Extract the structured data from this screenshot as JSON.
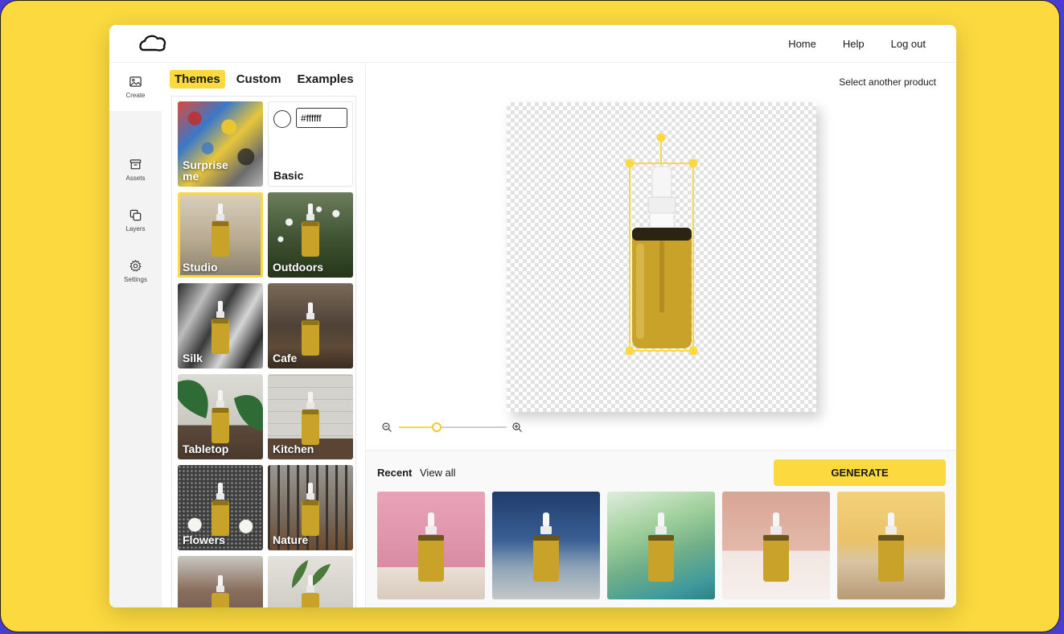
{
  "nav": {
    "home": "Home",
    "help": "Help",
    "logout": "Log out"
  },
  "rail": [
    {
      "label": "Create",
      "icon": "image-icon"
    },
    {
      "label": "Assets",
      "icon": "archive-icon"
    },
    {
      "label": "Layers",
      "icon": "layers-icon"
    },
    {
      "label": "Settings",
      "icon": "gear-icon"
    }
  ],
  "tabs": [
    "Themes",
    "Custom",
    "Examples"
  ],
  "basic": {
    "hex_value": "#ffffff"
  },
  "themes": [
    "Surprise me",
    "Basic",
    "Studio",
    "Outdoors",
    "Silk",
    "Cafe",
    "Tabletop",
    "Kitchen",
    "Flowers",
    "Nature"
  ],
  "select_product": "Select another product",
  "zoom_level": 0.35,
  "recent": {
    "title": "Recent",
    "view_all": "View all"
  },
  "generate_label": "GENERATE",
  "colors": {
    "accent": "#fbd93f",
    "background": "#4a3bd1",
    "oil": "#c9a22a"
  }
}
